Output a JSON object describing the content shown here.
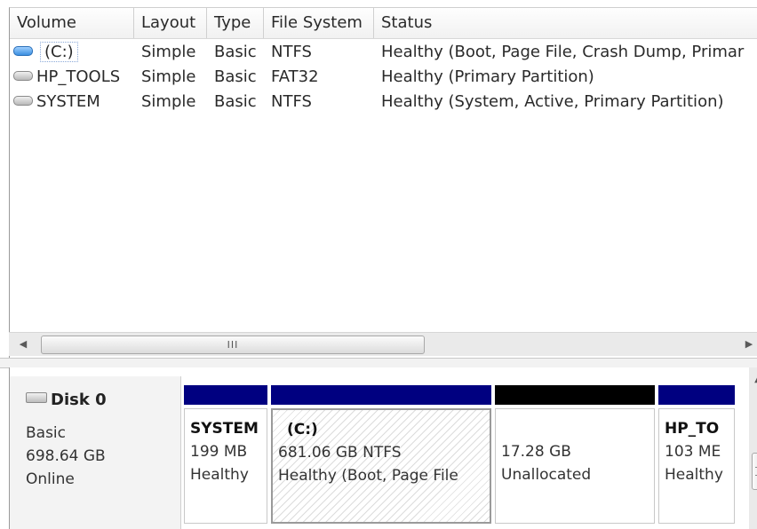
{
  "volume_list": {
    "columns": [
      "Volume",
      "Layout",
      "Type",
      "File System",
      "Status"
    ],
    "rows": [
      {
        "icon": "volume-blue-icon",
        "volume": "(C:)",
        "layout": "Simple",
        "type": "Basic",
        "file_system": "NTFS",
        "status": "Healthy (Boot, Page File, Crash Dump, Primar"
      },
      {
        "icon": "volume-gray-icon",
        "volume": "HP_TOOLS",
        "layout": "Simple",
        "type": "Basic",
        "file_system": "FAT32",
        "status": "Healthy (Primary Partition)"
      },
      {
        "icon": "volume-gray-icon",
        "volume": "SYSTEM",
        "layout": "Simple",
        "type": "Basic",
        "file_system": "NTFS",
        "status": "Healthy (System, Active, Primary Partition)"
      }
    ],
    "scroll_left_icon": "◀",
    "scroll_right_icon": "▶",
    "scroll_grip": "III"
  },
  "disk": {
    "title": "Disk 0",
    "type": "Basic",
    "size": "698.64 GB",
    "state": "Online",
    "icon": "disk-icon",
    "partitions": [
      {
        "label": "SYSTEM",
        "size": "199 MB",
        "status": "Healthy",
        "bar_color": "#000080"
      },
      {
        "label": "(C:)",
        "size": "681.06 GB NTFS",
        "status": "Healthy (Boot, Page File",
        "bar_color": "#000080"
      },
      {
        "label": "",
        "size": "17.28 GB",
        "status": "Unallocated",
        "bar_color": "#000000"
      },
      {
        "label": "HP_TO",
        "size": "103 ME",
        "status": "Healthy",
        "bar_color": "#000080"
      }
    ]
  },
  "colors": {
    "primary_partition_bar": "#000080",
    "unallocated_bar": "#000000",
    "hatch": "#dcdcdc"
  }
}
